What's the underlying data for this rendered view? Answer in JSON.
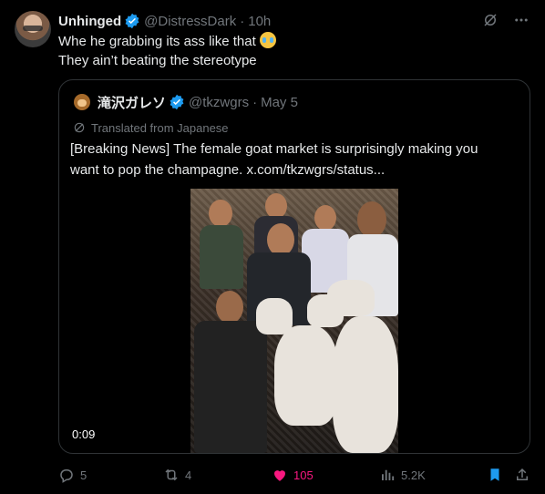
{
  "tweet": {
    "author_name": "Unhinged",
    "handle": "@DistressDark",
    "separator": "·",
    "time": "10h",
    "line1": "Whe he grabbing its ass like that",
    "emoji": "😭",
    "line2": "They ain’t beating the stereotype"
  },
  "quote": {
    "author_name": "滝沢ガレソ",
    "handle": "@tkzwgrs",
    "separator": "·",
    "date": "May 5",
    "translated_label": "Translated from Japanese",
    "text_line1": "[Breaking News] The female goat market is surprisingly making you",
    "text_line2": "want to pop the champagne. x.com/tkzwgrs/status...",
    "video_duration": "0:09"
  },
  "actions": {
    "replies": "5",
    "reposts": "4",
    "likes": "105",
    "views": "5.2K"
  },
  "colors": {
    "background": "#000000",
    "text": "#e7e9ea",
    "secondary": "#71767b",
    "verified_blue": "#1d9bf0",
    "like_pink": "#f91880",
    "border": "#2f3336"
  },
  "icons": [
    "verified-badge-icon",
    "grok-icon",
    "more-icon",
    "translate-icon",
    "reply-icon",
    "repost-icon",
    "like-icon",
    "views-icon",
    "bookmark-icon",
    "share-icon"
  ]
}
